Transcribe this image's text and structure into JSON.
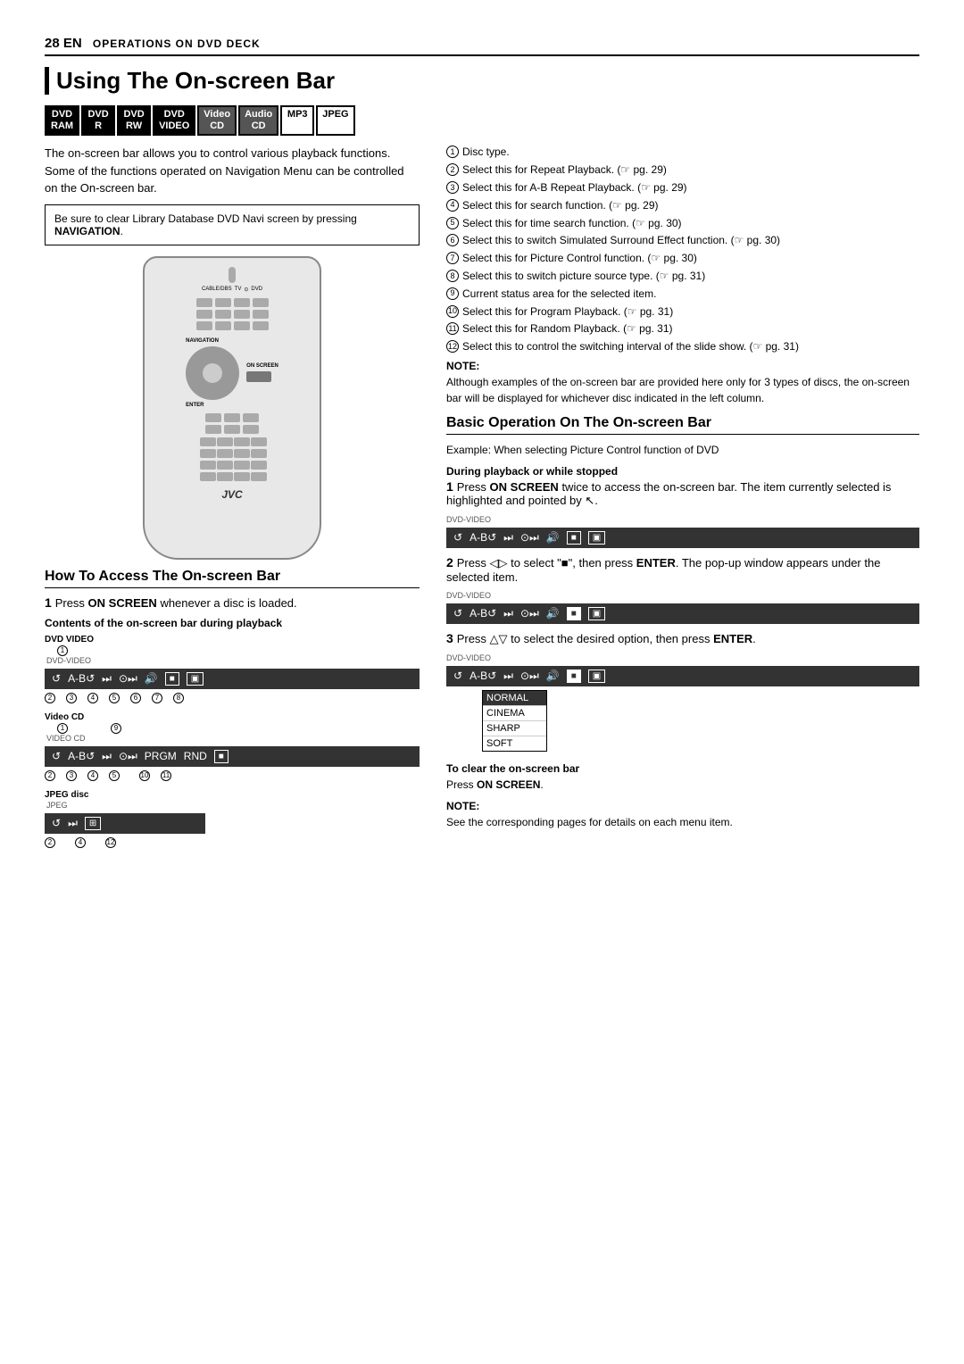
{
  "header": {
    "page_num": "28",
    "lang": "EN",
    "section": "OPERATIONS ON DVD DECK"
  },
  "title": "Using The On-screen Bar",
  "badges": [
    {
      "label": "DVD\nRAM",
      "style": "dark"
    },
    {
      "label": "DVD\nR",
      "style": "dark"
    },
    {
      "label": "DVD\nRW",
      "style": "dark"
    },
    {
      "label": "DVD\nVIDEO",
      "style": "dark"
    },
    {
      "label": "Video\nCD",
      "style": "highlight"
    },
    {
      "label": "Audio\nCD",
      "style": "highlight"
    },
    {
      "label": "MP3",
      "style": "normal"
    },
    {
      "label": "JPEG",
      "style": "normal"
    }
  ],
  "intro_text": "The on-screen bar allows you to control various playback functions. Some of the functions operated on Navigation Menu can be controlled on the On-screen bar.",
  "notice": "Be sure to clear Library Database DVD Navi screen by pressing NAVIGATION.",
  "how_to_section": {
    "title": "How To Access The On-screen Bar",
    "step1": "Press ON SCREEN whenever a disc is loaded.",
    "contents_label": "Contents of the on-screen bar during playback",
    "dvd_video_label": "DVD VIDEO",
    "video_cd_label": "Video CD",
    "jpeg_disc_label": "JPEG disc"
  },
  "numbered_items": [
    {
      "num": "1",
      "text": "Disc type."
    },
    {
      "num": "2",
      "text": "Select this for Repeat Playback. (☞ pg. 29)"
    },
    {
      "num": "3",
      "text": "Select this for A-B Repeat Playback. (☞ pg. 29)"
    },
    {
      "num": "4",
      "text": "Select this for search function. (☞ pg. 29)"
    },
    {
      "num": "5",
      "text": "Select this for time search function. (☞ pg. 30)"
    },
    {
      "num": "6",
      "text": "Select this to switch Simulated Surround Effect function. (☞ pg. 30)"
    },
    {
      "num": "7",
      "text": "Select this for Picture Control function. (☞ pg. 30)"
    },
    {
      "num": "8",
      "text": "Select this to switch picture source type. (☞ pg. 31)"
    },
    {
      "num": "9",
      "text": "Current status area for the selected item."
    },
    {
      "num": "10",
      "text": "Select this for Program Playback. (☞ pg. 31)"
    },
    {
      "num": "11",
      "text": "Select this for Random Playback. (☞ pg. 31)"
    },
    {
      "num": "12",
      "text": "Select this to control the switching interval of the slide show. (☞ pg. 31)"
    }
  ],
  "note_text": "Although examples of the on-screen bar are provided here only for 3 types of discs, the on-screen bar will be displayed for whichever disc indicated in the left column.",
  "basic_op_section": {
    "title": "Basic Operation On The On-screen Bar",
    "example": "Example: When selecting Picture Control function of DVD",
    "during_label": "During playback or while stopped",
    "step1": "Press ON SCREEN twice to access the on-screen bar. The item currently selected is highlighted and pointed by ↖.",
    "step2": "Press ◁▷ to select \"■\", then press ENTER. The pop-up window appears under the selected item.",
    "step3": "Press △▽ to select the desired option, then press ENTER.",
    "clear_label": "To clear the on-screen bar",
    "clear_text": "Press ON SCREEN.",
    "note2": "See the corresponding pages for details on each menu item.",
    "popup_options": [
      "NORMAL",
      "CINEMA",
      "SHARP",
      "SOFT"
    ],
    "selected_option": "NORMAL"
  },
  "remote": {
    "nav_label": "NAVIGATION",
    "on_screen_label": "ON SCREEN",
    "enter_label": "ENTER"
  },
  "dvd_bar_annotations": {
    "dvd_video": [
      "1",
      "2",
      "3",
      "4",
      "5",
      "6",
      "7",
      "8"
    ],
    "video_cd": [
      "2",
      "3",
      "4",
      "5",
      "9",
      "10",
      "11"
    ],
    "jpeg": [
      "2",
      "4",
      "12"
    ]
  }
}
